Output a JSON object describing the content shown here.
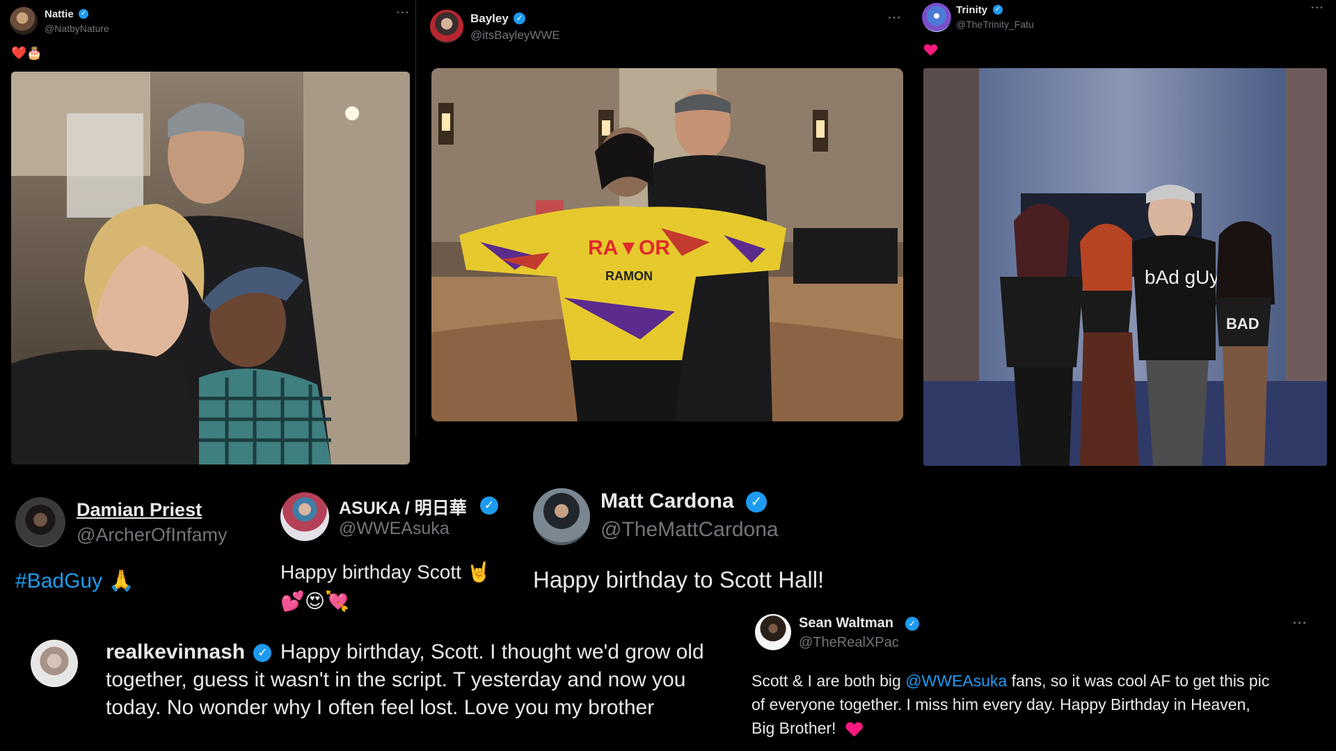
{
  "tweets": {
    "nattie": {
      "name": "Nattie",
      "handle": "@NatbyNature",
      "text": "❤️🎂",
      "more": "···"
    },
    "bayley": {
      "name": "Bayley",
      "handle": "@itsBayleyWWE",
      "more": "···"
    },
    "trinity": {
      "name": "Trinity",
      "handle": "@TheTrinity_Fatu",
      "more": "···"
    },
    "damian": {
      "name": "Damian Priest",
      "handle": "@ArcherOfInfamy",
      "text": "#BadGuy",
      "emoji": "🙏"
    },
    "asuka": {
      "name": "ASUKA / 明日華",
      "handle": "@WWEAsuka",
      "text_line1": "Happy birthday Scott 🤘",
      "text_line2": "💕😍💘"
    },
    "cardona": {
      "name": "Matt Cardona",
      "handle": "@TheMattCardona",
      "text": "Happy birthday to Scott Hall!"
    },
    "nash": {
      "name": "realkevinnash",
      "text_line1": "Happy birthday, Scott. I thought we'd grow old",
      "text_line2": "together, guess it wasn't in the script. T yesterday and now you",
      "text_line3": "today. No wonder why I often feel lost. Love you my brother"
    },
    "waltman": {
      "name": "Sean Waltman",
      "handle": "@TheRealXPac",
      "more": "···",
      "text_pre": "Scott & I are both big ",
      "mention": "@WWEAsuka",
      "text_post": " fans, so it was cool AF to get this pic",
      "text_line2": "of everyone together. I miss him every day. Happy Birthday in Heaven,",
      "text_line3": "Big Brother!"
    }
  },
  "photos": {
    "bayley_jacket_text1": "RA▼OR",
    "bayley_jacket_text2": "RAMON",
    "trinity_shirt_text": "bAd gUy",
    "trinity_tee_text": "BAD"
  },
  "colors": {
    "background": "#000000",
    "text": "#e7e9ea",
    "muted": "#71767b",
    "accent_blue": "#1d9bf0",
    "heart_red": "#f91880"
  },
  "icons": {
    "verified": "verified-badge-icon",
    "more": "more-options-icon",
    "heart": "heart-icon"
  }
}
